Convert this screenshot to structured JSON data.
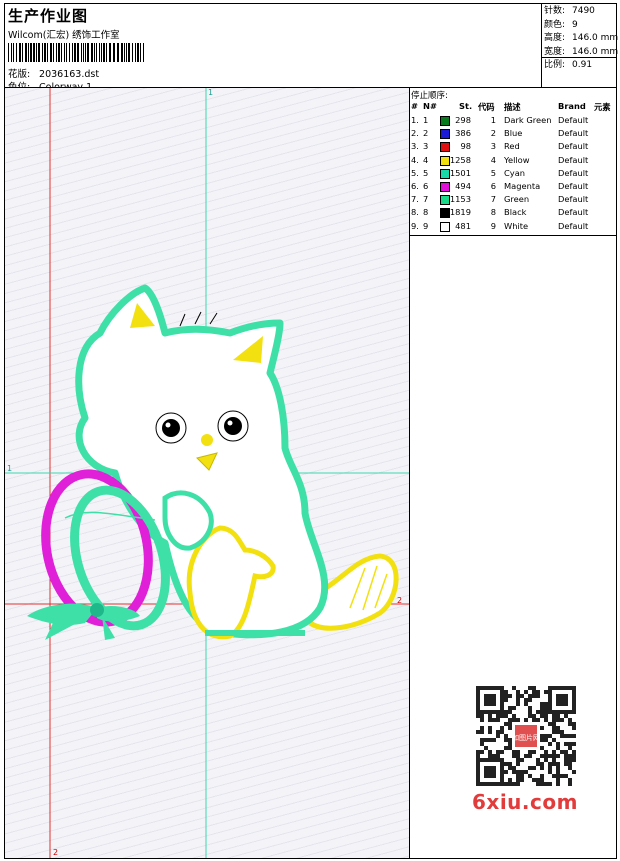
{
  "header": {
    "title": "生产作业图",
    "company": "Wilcom(汇宏) 绣饰工作室",
    "design_label": "花版:",
    "design_value": "2036163.dst",
    "colorway_label": "色位:",
    "colorway_value": "Colorway 1"
  },
  "stats": [
    {
      "label": "针数:",
      "value": "7490"
    },
    {
      "label": "颜色:",
      "value": "9"
    },
    {
      "label": "高度:",
      "value": "146.0 mm"
    },
    {
      "label": "宽度:",
      "value": "146.0 mm"
    },
    {
      "label": "比例:",
      "value": "0.91"
    }
  ],
  "guides": {
    "top_label": "1",
    "left_label": "1",
    "right_label": "2",
    "bottom_label": "2"
  },
  "stop_sequence": {
    "title": "停止顺序:",
    "columns": [
      "#",
      "N#",
      "St.",
      "代码",
      "描述",
      "Brand",
      "元素"
    ],
    "rows": [
      {
        "idx": "1.",
        "n": "1",
        "color": "#0a7a1e",
        "st": "298",
        "code": "1",
        "desc": "Dark Green",
        "brand": "Default"
      },
      {
        "idx": "2.",
        "n": "2",
        "color": "#1b1bd6",
        "st": "386",
        "code": "2",
        "desc": "Blue",
        "brand": "Default"
      },
      {
        "idx": "3.",
        "n": "3",
        "color": "#e01010",
        "st": "98",
        "code": "3",
        "desc": "Red",
        "brand": "Default"
      },
      {
        "idx": "4.",
        "n": "4",
        "color": "#f0e010",
        "st": "1258",
        "code": "4",
        "desc": "Yellow",
        "brand": "Default"
      },
      {
        "idx": "5.",
        "n": "5",
        "color": "#19d9a8",
        "st": "1501",
        "code": "5",
        "desc": "Cyan",
        "brand": "Default"
      },
      {
        "idx": "6.",
        "n": "6",
        "color": "#e010d8",
        "st": "494",
        "code": "6",
        "desc": "Magenta",
        "brand": "Default"
      },
      {
        "idx": "7.",
        "n": "7",
        "color": "#19d98a",
        "st": "1153",
        "code": "7",
        "desc": "Green",
        "brand": "Default"
      },
      {
        "idx": "8.",
        "n": "8",
        "color": "#000000",
        "st": "1819",
        "code": "8",
        "desc": "Black",
        "brand": "Default"
      },
      {
        "idx": "9.",
        "n": "9",
        "color": "#ffffff",
        "st": "481",
        "code": "9",
        "desc": "White",
        "brand": "Default"
      }
    ]
  },
  "watermark": {
    "brand_text": "6xiu.com",
    "seal_text": "如图片网"
  },
  "colors": {
    "guide_red": "#e03030",
    "guide_teal": "#3cd6b0",
    "outline_green": "#3ee0a8",
    "ear_yellow": "#f2e010",
    "ribbon_magenta": "#e020d8"
  }
}
